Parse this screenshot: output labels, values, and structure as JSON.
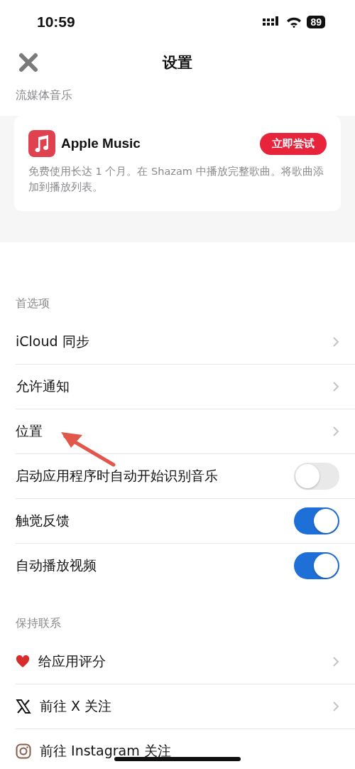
{
  "status_bar": {
    "time": "10:59",
    "battery": "89"
  },
  "nav": {
    "title": "设置"
  },
  "streaming": {
    "header": "流媒体音乐",
    "card": {
      "name": "Apple Music",
      "button": "立即尝试",
      "description": "免费使用长达 1 个月。在 Shazam 中播放完整歌曲。将歌曲添加到播放列表。"
    }
  },
  "preferences": {
    "header": "首选项",
    "rows": [
      {
        "kind": "link",
        "label": "iCloud 同步"
      },
      {
        "kind": "link",
        "label": "允许通知"
      },
      {
        "kind": "link",
        "label": "位置"
      },
      {
        "kind": "toggle",
        "label": "启动应用程序时自动开始识别音乐",
        "on": false
      },
      {
        "kind": "toggle",
        "label": "触觉反馈",
        "on": true
      },
      {
        "kind": "toggle",
        "label": "自动播放视频",
        "on": true
      }
    ]
  },
  "contact": {
    "header": "保持联系",
    "rows": [
      {
        "label": "给应用评分",
        "chevron": true
      },
      {
        "label": "前往 X 关注",
        "chevron": true
      },
      {
        "label": "前往 Instagram 关注",
        "chevron": false
      }
    ]
  }
}
